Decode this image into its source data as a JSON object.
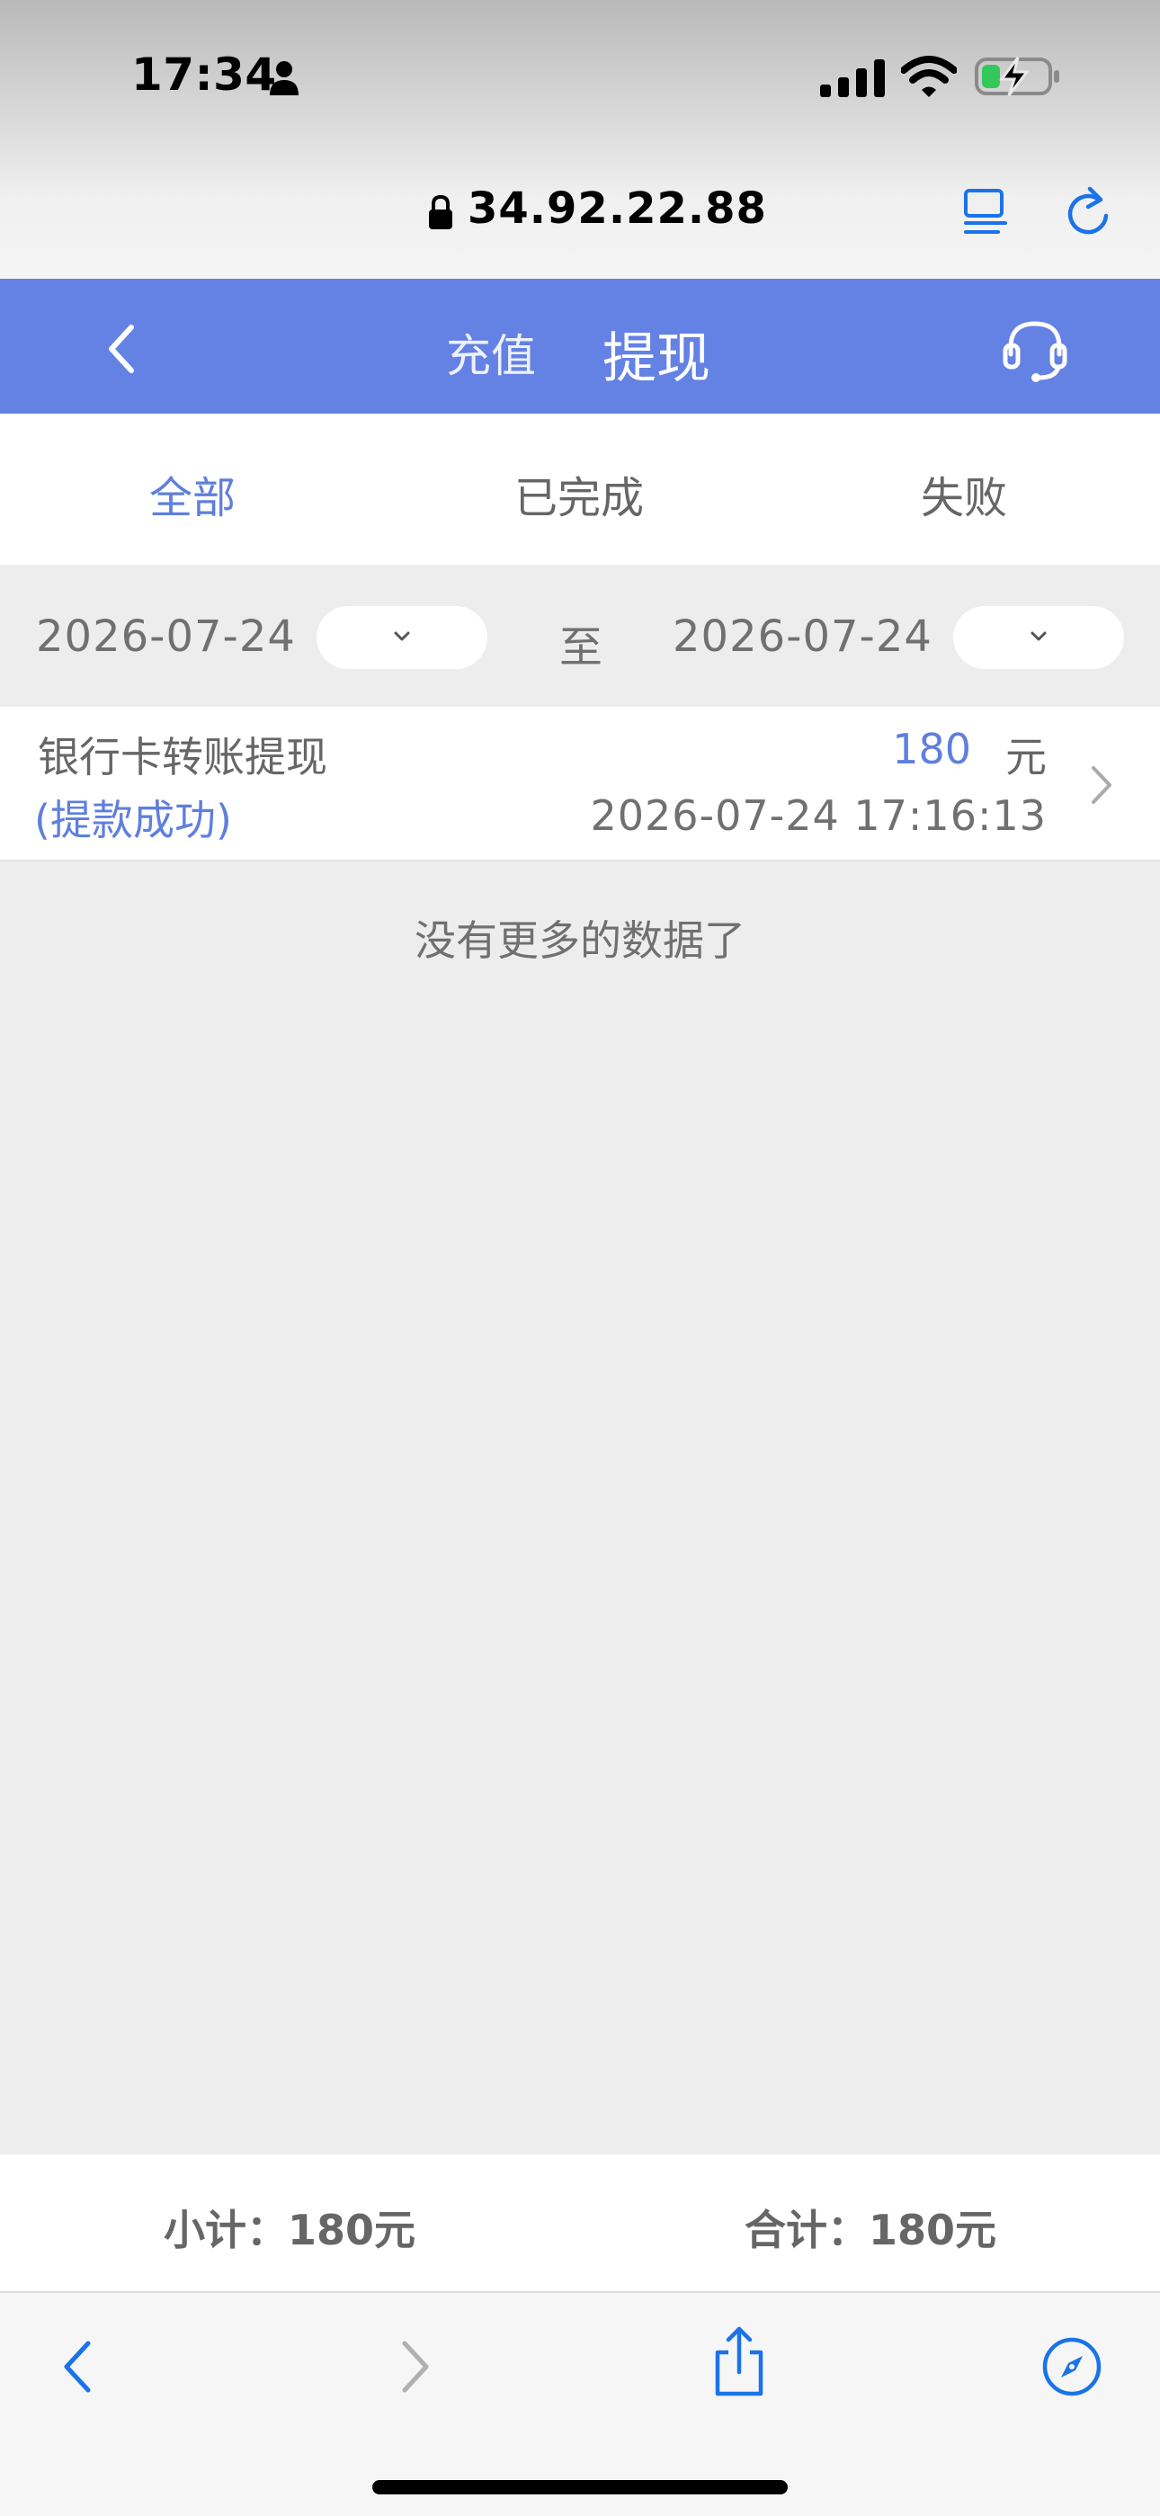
{
  "status_bar": {
    "time": "17:34"
  },
  "browser": {
    "url": "34.92.22.88"
  },
  "header": {
    "tabs": [
      {
        "label": "充值",
        "active": false
      },
      {
        "label": "提现",
        "active": true
      }
    ],
    "accent_color": "#6481e4"
  },
  "filter_tabs": [
    {
      "label": "全部",
      "active": true
    },
    {
      "label": "已完成",
      "active": false
    },
    {
      "label": "失败",
      "active": false
    }
  ],
  "date_range": {
    "start": "2026-07-24",
    "separator": "至",
    "end": "2026-07-24"
  },
  "records": [
    {
      "type": "银行卡转账提现",
      "status": "(提款成功)",
      "amount": "180",
      "unit": "元",
      "time": "2026-07-24 17:16:13"
    }
  ],
  "no_more_text": "没有更多的数据了",
  "totals": {
    "subtotal": "小计：180元",
    "total": "合计：180元"
  },
  "icons": {
    "status": [
      "person-icon",
      "signal-icon",
      "wifi-icon",
      "battery-charging-icon"
    ],
    "browser": [
      "lock-icon",
      "reader-mode-icon",
      "reload-icon"
    ],
    "header": [
      "back-arrow-icon",
      "customer-service-headset-icon"
    ],
    "toolbar": [
      "back-icon",
      "forward-icon",
      "share-icon",
      "compass-icon"
    ]
  },
  "colors": {
    "accent_blue": "#5f7fdc",
    "safari_blue": "#1a73e8"
  }
}
